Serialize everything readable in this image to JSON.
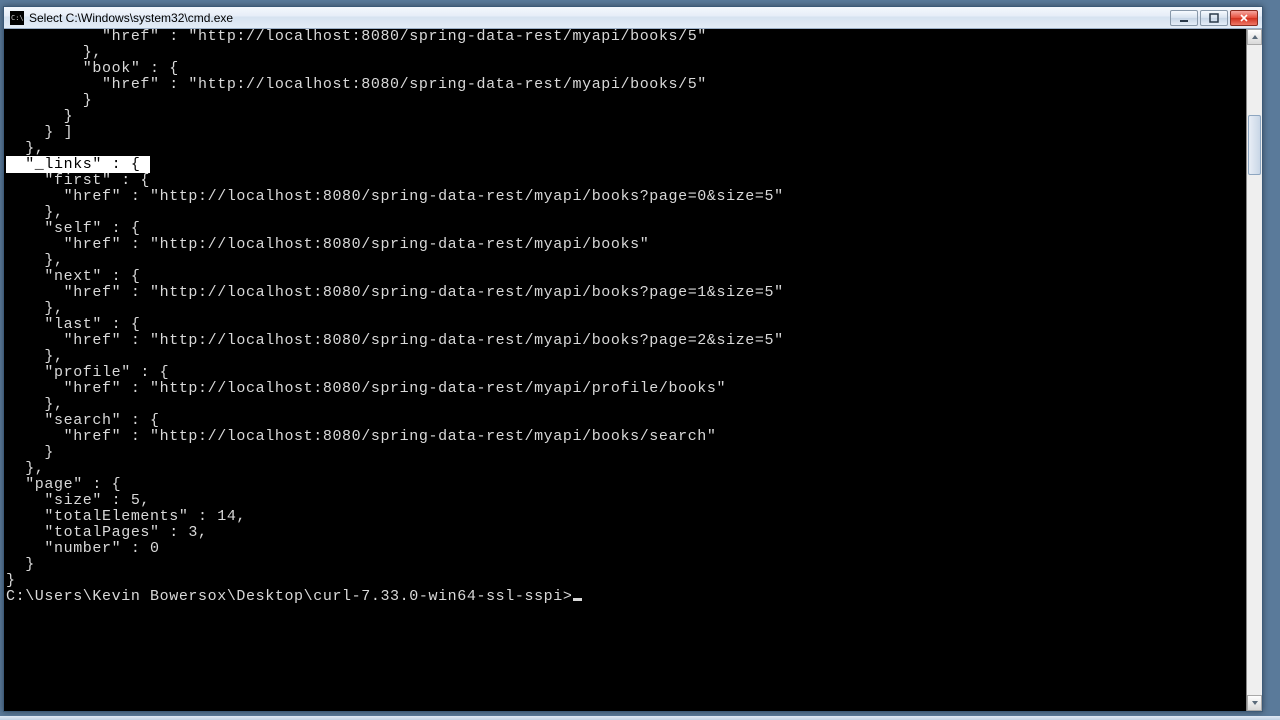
{
  "window": {
    "title": "Select C:\\Windows\\system32\\cmd.exe",
    "buttons": {
      "min": "minimize",
      "max": "maximize",
      "close": "close"
    }
  },
  "terminal": {
    "lines_before": [
      "          \"href\" : \"http://localhost:8080/spring-data-rest/myapi/books/5\"",
      "        },",
      "        \"book\" : {",
      "          \"href\" : \"http://localhost:8080/spring-data-rest/myapi/books/5\"",
      "        }",
      "      }",
      "    } ]",
      "  },"
    ],
    "highlight_prefix": "  ",
    "highlight_text": "\"_links\" : { ",
    "lines_after": [
      "    \"first\" : {",
      "      \"href\" : \"http://localhost:8080/spring-data-rest/myapi/books?page=0&size=5\"",
      "    },",
      "    \"self\" : {",
      "      \"href\" : \"http://localhost:8080/spring-data-rest/myapi/books\"",
      "    },",
      "    \"next\" : {",
      "      \"href\" : \"http://localhost:8080/spring-data-rest/myapi/books?page=1&size=5\"",
      "    },",
      "    \"last\" : {",
      "      \"href\" : \"http://localhost:8080/spring-data-rest/myapi/books?page=2&size=5\"",
      "    },",
      "    \"profile\" : {",
      "      \"href\" : \"http://localhost:8080/spring-data-rest/myapi/profile/books\"",
      "    },",
      "    \"search\" : {",
      "      \"href\" : \"http://localhost:8080/spring-data-rest/myapi/books/search\"",
      "    }",
      "  },",
      "  \"page\" : {",
      "    \"size\" : 5,",
      "    \"totalElements\" : 14,",
      "    \"totalPages\" : 3,",
      "    \"number\" : 0",
      "  }",
      "}"
    ],
    "prompt": "C:\\Users\\Kevin Bowersox\\Desktop\\curl-7.33.0-win64-ssl-sspi>"
  }
}
